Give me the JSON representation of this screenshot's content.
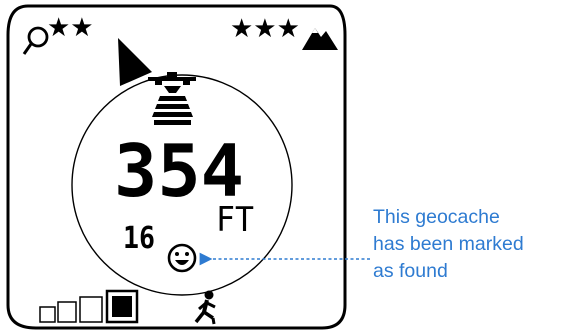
{
  "display": {
    "difficulty_stars": "★★",
    "terrain_stars": "★★★",
    "distance": "354",
    "unit": "FT",
    "side_value": "16",
    "found_icon": "smiley-face-icon",
    "satellite_icon": "satellite-icon",
    "search_icon": "magnifier-icon",
    "terrain_icon": "mountain-icon",
    "walking_icon": "walking-person-icon",
    "bearing_pointer_icon": "direction-arrow-icon",
    "signal_level": 4
  },
  "annotation": {
    "lines": [
      "This geocache",
      "has been marked",
      "as found"
    ],
    "color": "#2e7bd1"
  }
}
